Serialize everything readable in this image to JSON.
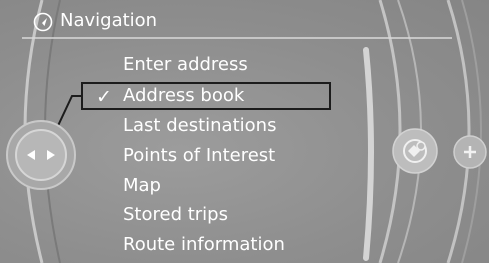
{
  "header": {
    "title": "Navigation",
    "icon": "navigation-arrow-icon"
  },
  "menu": {
    "items": [
      {
        "label": "Enter address",
        "checked": false
      },
      {
        "label": "Address book",
        "checked": true,
        "check_glyph": "✓"
      },
      {
        "label": "Last destinations",
        "checked": false
      },
      {
        "label": "Points of Interest",
        "checked": false
      },
      {
        "label": "Map",
        "checked": false
      },
      {
        "label": "Stored trips",
        "checked": false
      },
      {
        "label": "Route information",
        "checked": false
      }
    ],
    "selected_index": 1
  },
  "controls": {
    "left_knob_icon": "left-right-arrows-icon",
    "right_button_icon": "map-settings-icon",
    "plus_button_icon": "plus-icon"
  },
  "colors": {
    "background": "#8e8e8e",
    "text": "#ffffff",
    "highlight_border": "#1c1c1c"
  }
}
